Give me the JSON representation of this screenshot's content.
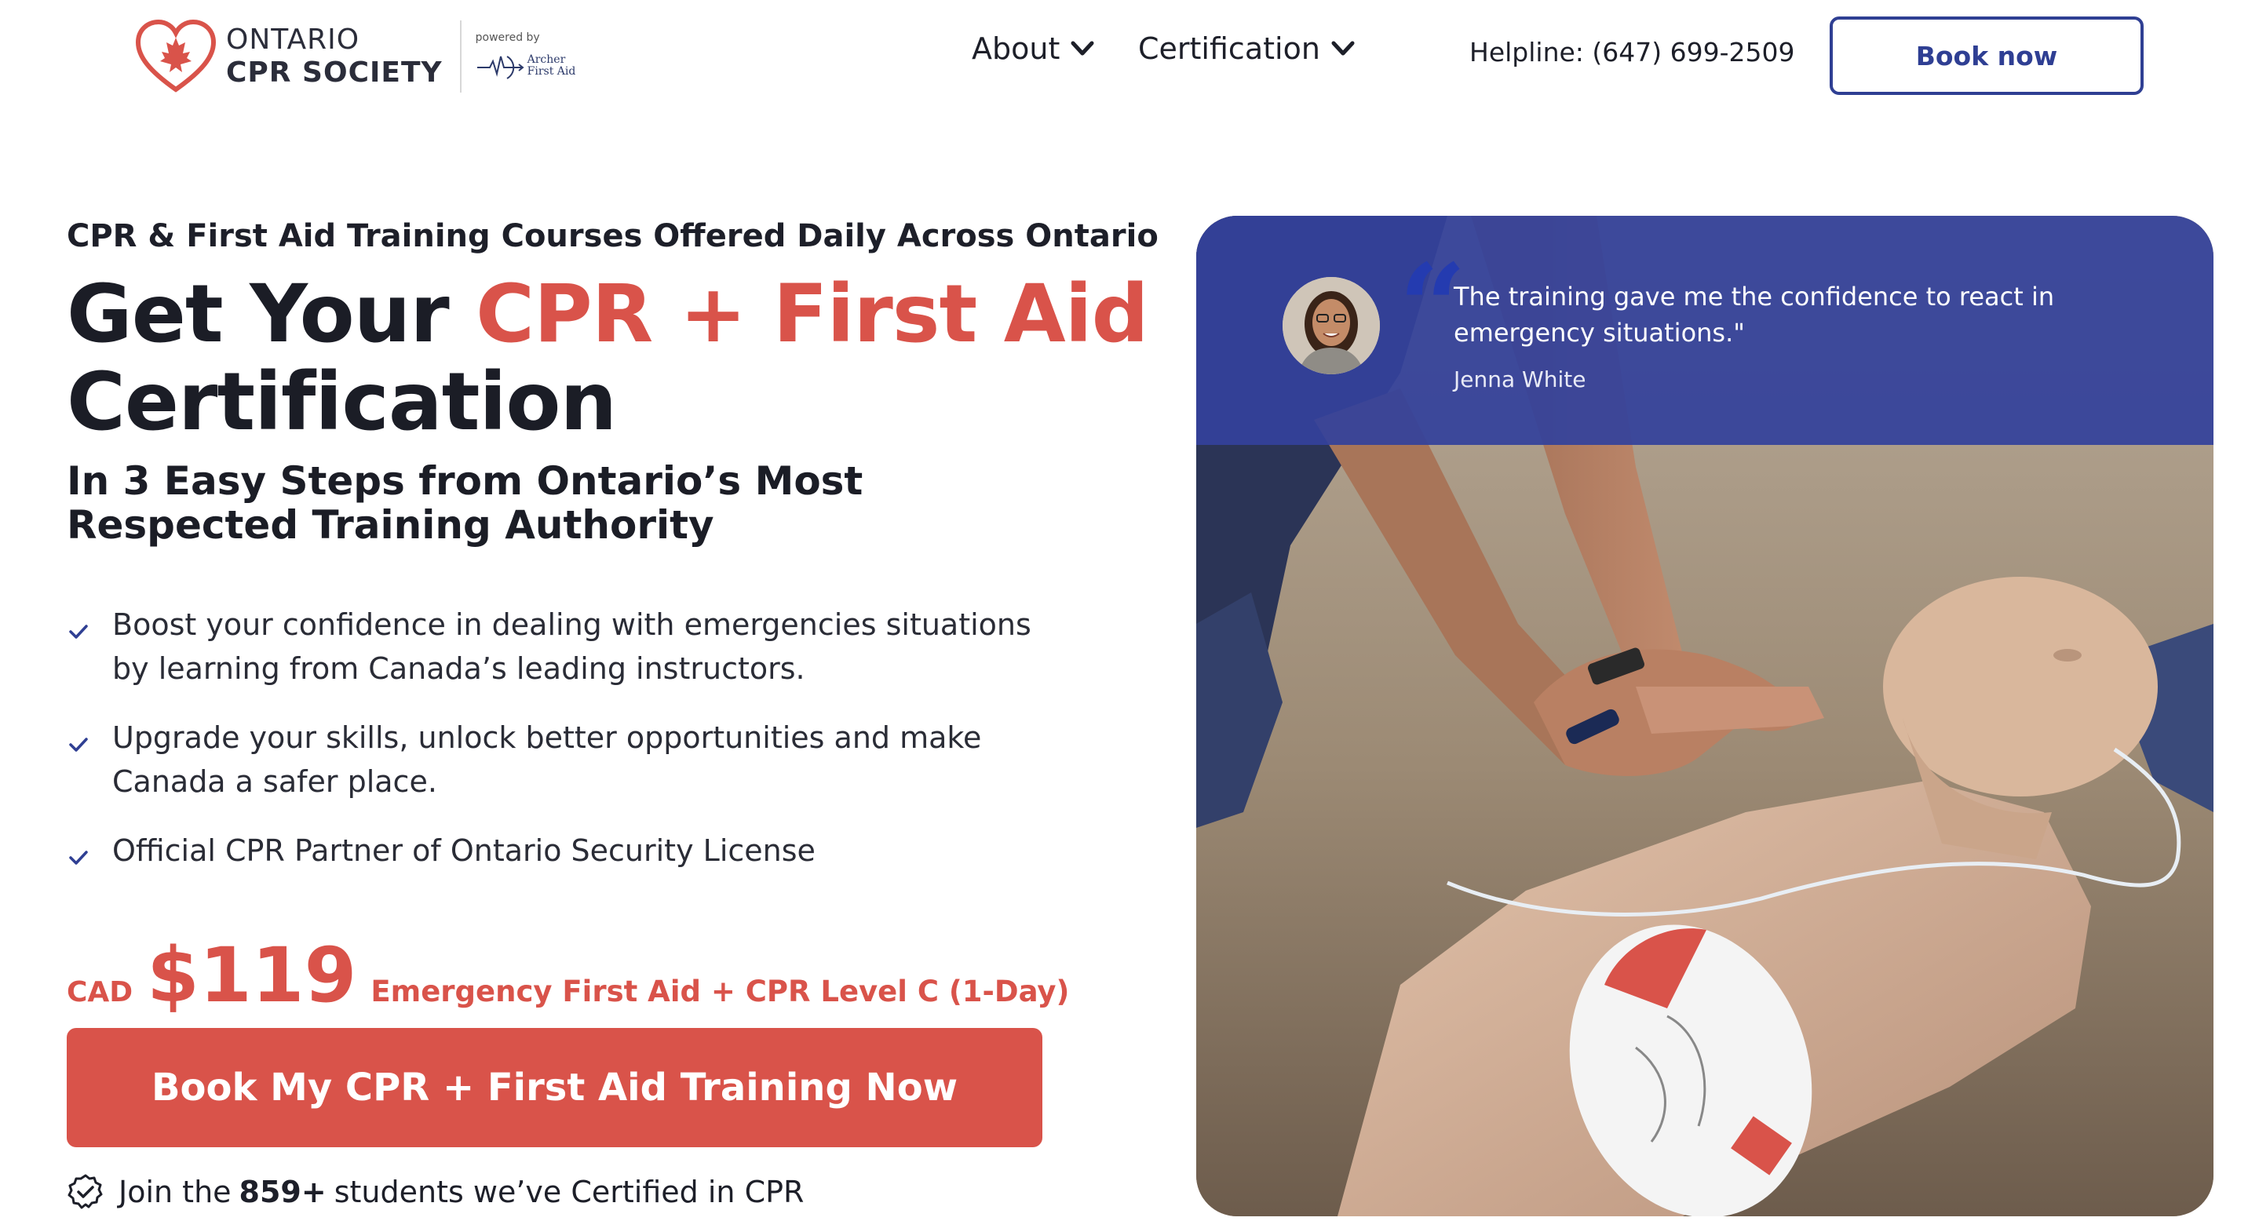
{
  "header": {
    "logo": {
      "line1": "ONTARIO",
      "line2": "CPR SOCIETY",
      "powered_by": "powered by",
      "partner_line1": "Archer",
      "partner_line2": "First Aid"
    },
    "nav": [
      {
        "label": "About",
        "icon": "chevron-down-icon"
      },
      {
        "label": "Certification",
        "icon": "chevron-down-icon"
      }
    ],
    "helpline": "Helpline: (647) 699-2509",
    "book_button": "Book now"
  },
  "hero": {
    "eyebrow": "CPR & First Aid Training Courses Offered Daily Across Ontario",
    "title_part1": "Get Your ",
    "title_highlight": "CPR + First Aid",
    "title_part2": "Certification",
    "subtitle": "In 3 Easy Steps from Ontario’s Most Respected Training Authority",
    "benefits": [
      "Boost your confidence in dealing with emergencies situations by learning from Canada’s leading instructors.",
      "Upgrade your skills, unlock better opportunities and make Canada a safer place.",
      "Official CPR Partner of Ontario Security License"
    ],
    "price": {
      "currency": "CAD",
      "amount": "$119",
      "course": "Emergency First Aid + CPR Level C (1-Day)"
    },
    "cta": "Book My CPR + First Aid Training Now",
    "social_proof": {
      "prefix": "Join the",
      "count": "859+",
      "suffix": "students we’ve Certified in CPR"
    }
  },
  "testimonial": {
    "quote": "The training gave me the confidence to react in emergency situations.\"",
    "author": "Jenna White"
  },
  "colors": {
    "accent_red": "#d9534a",
    "brand_blue": "#2f3f93",
    "text_dark": "#1b1d26"
  }
}
